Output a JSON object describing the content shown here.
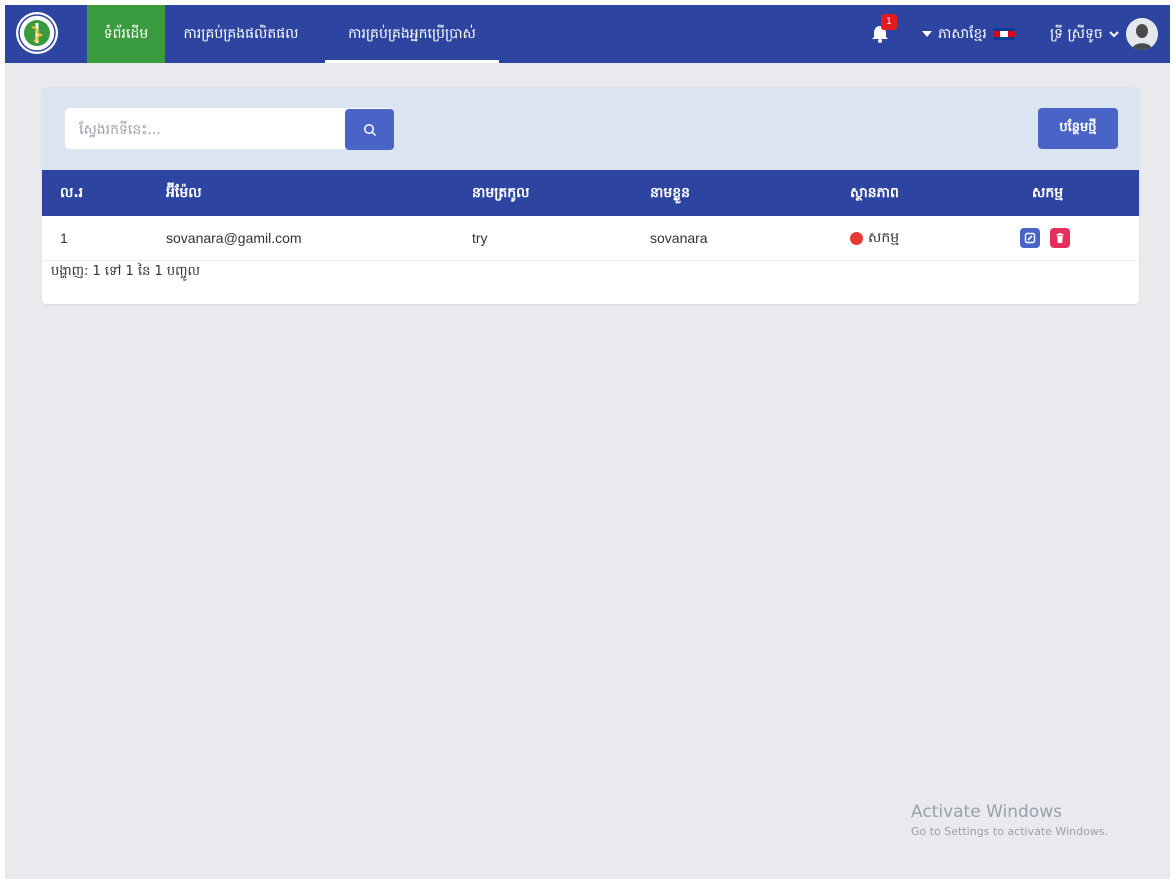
{
  "navbar": {
    "home": "ទំព័រដើម",
    "products": "ការគ្រប់គ្រងផលិតផល",
    "users": "ការគ្រប់គ្រងអ្នកប្រើប្រាស់",
    "notification_count": "1",
    "language": "ភាសាខ្មែរ",
    "user_name": "ទ្រី ស្រីទូច"
  },
  "toolbar": {
    "search_placeholder": "ស្វែងរកទីនេះ...",
    "add_label": "បន្ថែមថ្មី"
  },
  "table": {
    "headers": [
      "ល.រ",
      "អ៊ីម៉ែល",
      "នាមត្រកូល",
      "នាមខ្លួន",
      "ស្ថានភាព",
      "សកម្ម"
    ],
    "rows": [
      {
        "no": "1",
        "email": "sovanara@gamil.com",
        "last_name": "try",
        "first_name": "sovanara",
        "status": "សកម្ម"
      }
    ]
  },
  "pagination_info": "បង្ហាញ: 1 ទៅ 1 នៃ 1 បញ្ចូល",
  "watermark": {
    "title": "Activate Windows",
    "subtitle": "Go to Settings to activate Windows."
  },
  "colors": {
    "navbar": "#2d44a1",
    "home_active": "#3a9a3e",
    "primary_button": "#4a63c6",
    "delete_button": "#e62e5c",
    "status_dot": "#e53935"
  }
}
